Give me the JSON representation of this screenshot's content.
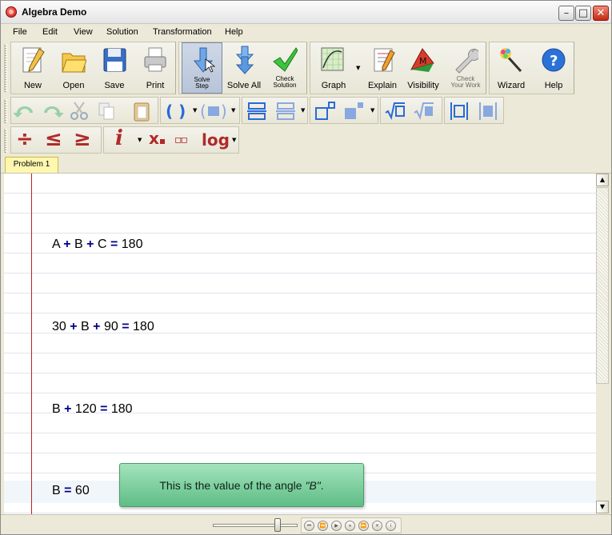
{
  "window": {
    "title": "Algebra Demo",
    "min_glyph": "–",
    "max_glyph": "□",
    "close_glyph": "✕"
  },
  "menu": [
    "File",
    "Edit",
    "View",
    "Solution",
    "Transformation",
    "Help"
  ],
  "toolbar1": {
    "new": "New",
    "open": "Open",
    "save": "Save",
    "print": "Print",
    "solve_step_1": "Solve",
    "solve_step_2": "Step",
    "solve_all": "Solve All",
    "check_solution_1": "Check",
    "check_solution_2": "Solution",
    "graph": "Graph",
    "explain": "Explain",
    "visibility": "Visibility",
    "check_work_1": "Check",
    "check_work_2": "Your Work",
    "wizard": "Wizard",
    "help": "Help",
    "help_glyph": "?",
    "visibility_glyph": "M"
  },
  "toolbar3": {
    "divide": "÷",
    "le": "≤",
    "ge": "≥",
    "info": "i",
    "subscript": "x",
    "fraction": "▫▫",
    "log": "log"
  },
  "tabs": [
    "Problem 1"
  ],
  "equations": [
    {
      "a": "A",
      "op1": "+",
      "b": "B",
      "op2": "+",
      "c": "C",
      "eq": "=",
      "r": "180"
    },
    {
      "a": "30",
      "op1": "+",
      "b": "B",
      "op2": "+",
      "c": "90",
      "eq": "=",
      "r": "180"
    },
    {
      "a": "B",
      "op1": "+",
      "b": "120",
      "eq": "=",
      "r": "180"
    },
    {
      "a": "B",
      "eq": "=",
      "r": "60"
    }
  ],
  "tooltip": {
    "prefix": "This is the value of the angle ",
    "var": "\"B\"",
    "suffix": "."
  },
  "colors": {
    "operator": "#00008a",
    "margin": "#c02020",
    "tooltip": "#7fcf9f",
    "tab": "#fff7b0"
  },
  "player": [
    "⏮",
    "⏪",
    "▶",
    "⏸",
    "⏩",
    "✕",
    "i"
  ],
  "scrollbar": {
    "up": "▲",
    "down": "▼"
  }
}
